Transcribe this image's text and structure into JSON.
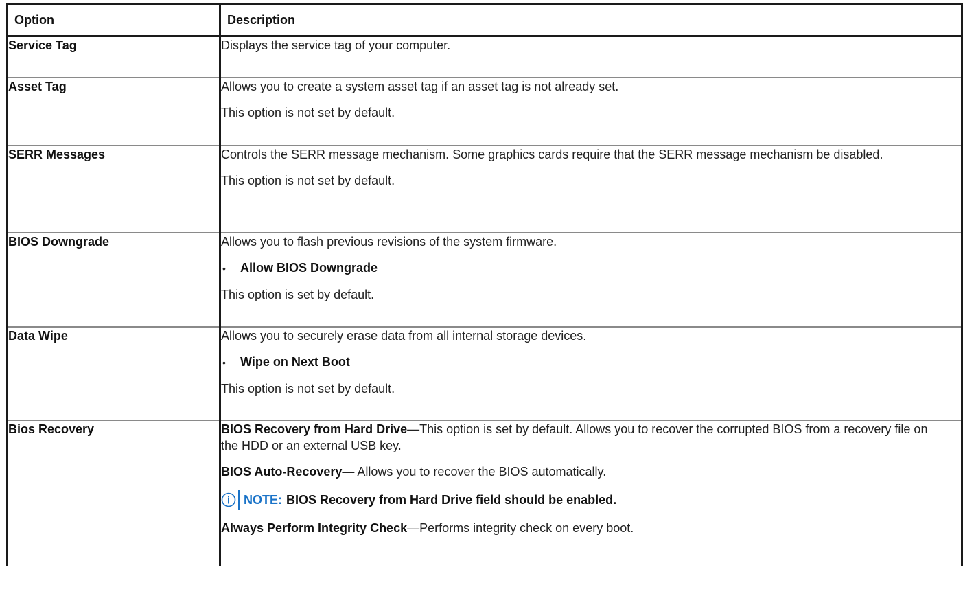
{
  "table": {
    "header": {
      "option": "Option",
      "description": "Description"
    },
    "rows": [
      {
        "option": "Service Tag",
        "description": "Displays the service tag of your computer."
      },
      {
        "option": "Asset Tag",
        "description": "Allows you to create a system asset tag if an asset tag is not already set.",
        "default": "This option is not set by default."
      },
      {
        "option": "SERR Messages",
        "description": "Controls the SERR message mechanism. Some graphics cards require that the SERR message mechanism be disabled.",
        "default": "This option is not set by default."
      },
      {
        "option": "BIOS Downgrade",
        "description": "Allows you to flash previous revisions of the system firmware.",
        "bullet": "Allow BIOS Downgrade",
        "default": "This option is set by default."
      },
      {
        "option": "Data Wipe",
        "description": "Allows you to securely erase data from all internal storage devices.",
        "bullet": "Wipe on Next Boot",
        "default": "This option is not set by default."
      },
      {
        "option": "Bios Recovery",
        "item1_term": "BIOS Recovery from Hard Drive",
        "item1_text": "—This option is set by default. Allows you to recover the corrupted BIOS from a recovery file on the HDD or an external USB key.",
        "item2_term": "BIOS Auto-Recovery",
        "item2_text": "— Allows you to recover the BIOS automatically.",
        "note_label": "NOTE:",
        "note_text": "BIOS Recovery from Hard Drive field should be enabled.",
        "item3_term": "Always Perform Integrity Check",
        "item3_text": "—Performs integrity check on every boot."
      }
    ]
  },
  "colors": {
    "note_accent": "#1a73c8",
    "border": "#1a1a1a",
    "row_divider": "#8a8a8a"
  },
  "icons": {
    "note": "info-icon",
    "bullet": "bullet-dot"
  }
}
